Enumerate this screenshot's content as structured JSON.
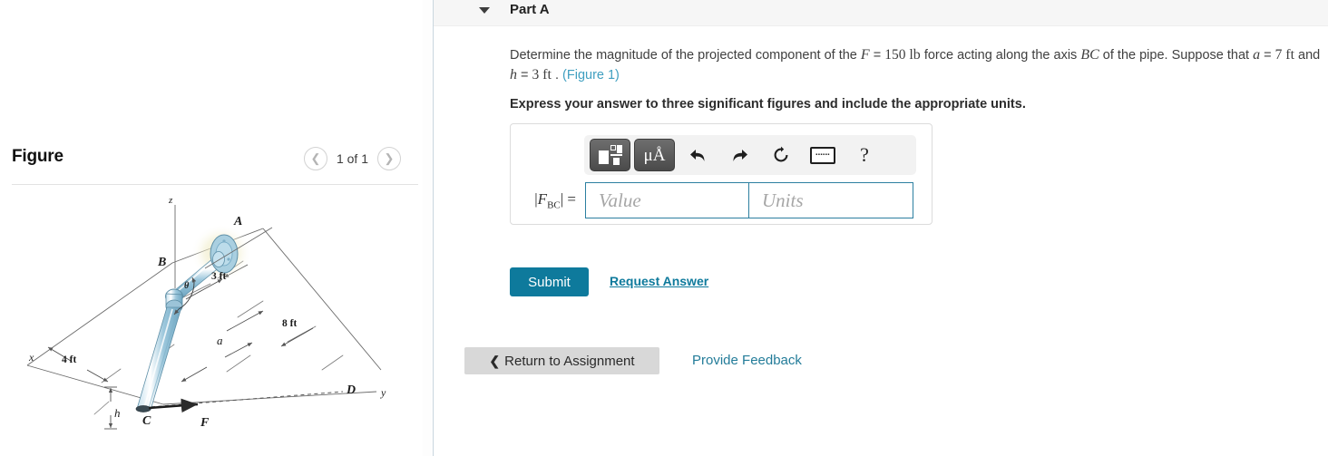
{
  "left": {
    "figure_title": "Figure",
    "nav": {
      "prev_icon": "chevron-left-icon",
      "next_icon": "chevron-right-icon",
      "counter": "1 of 1"
    },
    "diagram": {
      "description": "Isometric sketch of a bent pipe ABC anchored by a flange at A with a force F applied at C",
      "labels": {
        "axis_x": "x",
        "axis_y": "y",
        "axis_z": "z",
        "point_A": "A",
        "point_B": "B",
        "point_C": "C",
        "point_D": "D",
        "force": "F",
        "angle": "θ",
        "dim_a": "a",
        "dim_h": "h",
        "dim_3ft": "3 ft",
        "dim_8ft": "8 ft",
        "dim_4ft": "4 ft"
      }
    }
  },
  "right": {
    "part": {
      "caret_icon": "caret-down-icon",
      "title": "Part A"
    },
    "question": {
      "seg1": "Determine the magnitude of the projected component of the ",
      "var_F": "F",
      "eq1": " = ",
      "val_150": "150 ",
      "unit_lb": "lb",
      "seg2": " force acting along the axis ",
      "var_BC": "BC",
      "seg3": " of the pipe. Suppose that ",
      "var_a": "a",
      "eq2": " = ",
      "val_7": "7 ",
      "unit_ft1": "ft",
      "seg4": " and ",
      "var_h": "h",
      "eq3": " = ",
      "val_3": "3 ",
      "unit_ft2": "ft",
      "seg5": " . ",
      "figure_link": "(Figure 1)"
    },
    "instruction": "Express your answer to three significant figures and include the appropriate units.",
    "answer": {
      "toolbar": {
        "template_icon": "math-template-icon",
        "units_label": "μÅ",
        "undo_icon": "undo-arrow-icon",
        "redo_icon": "redo-arrow-icon",
        "reset_icon": "reset-circular-arrow-icon",
        "keyboard_icon": "keyboard-icon",
        "keyboard_keys": "▪▪▪▪▪▪",
        "help_icon": "question-mark-icon",
        "help_label": "?"
      },
      "label_bar_open": "|",
      "label_F": "F",
      "label_sub": "BC",
      "label_bar_close": "|",
      "label_equals": "=",
      "value_placeholder": "Value",
      "value_current": "",
      "units_placeholder": "Units",
      "units_current": ""
    },
    "actions": {
      "submit_label": "Submit",
      "request_answer_label": "Request Answer",
      "return_chevron": "❮",
      "return_label": "Return to Assignment",
      "provide_feedback_label": "Provide Feedback"
    }
  },
  "colors": {
    "accent_teal": "#0e7a9c",
    "link_blue": "#237c99",
    "figure_link": "#3f9fc0",
    "header_bg": "#f6f6f6",
    "return_bg": "#d8d8d8",
    "input_border": "#2c7fa0",
    "pipe_fill": "#a9cfe0"
  }
}
